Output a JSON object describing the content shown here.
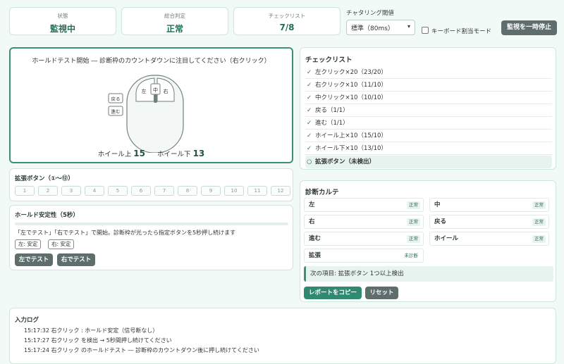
{
  "stats": [
    {
      "label": "状態",
      "value": "監視中"
    },
    {
      "label": "総合判定",
      "value": "正常"
    },
    {
      "label": "チェックリスト",
      "value": "7/8"
    }
  ],
  "controls": {
    "chatter_label": "チャタリング閾値",
    "chatter_value": "標準（80ms）",
    "keyboard_mode_label": "キーボード割当モード",
    "pause_button": "監視を一時停止"
  },
  "main": {
    "instruction": "ホールドテスト開始 ― 診断枠のカウントダウンに注目してください（右クリック）",
    "mouse": {
      "left": "左",
      "middle": "中",
      "right": "右",
      "back": "戻る",
      "forward": "進む"
    },
    "wheel_up_label": "ホイール上",
    "wheel_up_value": "15",
    "wheel_down_label": "ホイール下",
    "wheel_down_value": "13"
  },
  "extended": {
    "title": "拡張ボタン（①〜⑫）",
    "buttons": [
      "1",
      "2",
      "3",
      "4",
      "5",
      "6",
      "7",
      "8",
      "9",
      "10",
      "11",
      "12"
    ]
  },
  "hold": {
    "title": "ホールド安定性（5秒）",
    "progress": 0,
    "description": "「左でテスト」「右でテスト」で開始。診断枠が光ったら指定ボタンを5秒押し続けます",
    "left_status": "左: 安定",
    "right_status": "右: 安定",
    "left_test_button": "左でテスト",
    "right_test_button": "右でテスト"
  },
  "checklist": {
    "title": "チェックリスト",
    "items": [
      {
        "mark": "✓",
        "label": "左クリック×20（23/20）"
      },
      {
        "mark": "✓",
        "label": "右クリック×10（11/10）"
      },
      {
        "mark": "✓",
        "label": "中クリック×10（10/10）"
      },
      {
        "mark": "✓",
        "label": "戻る（1/1）"
      },
      {
        "mark": "✓",
        "label": "進む（1/1）"
      },
      {
        "mark": "✓",
        "label": "ホイール上×10（15/10）"
      },
      {
        "mark": "✓",
        "label": "ホイール下×10（13/10）"
      },
      {
        "mark": "○",
        "label": "拡張ボタン（未検出）"
      }
    ]
  },
  "diagnosis": {
    "title": "診断カルテ",
    "cells": [
      {
        "name": "左",
        "status": "正常"
      },
      {
        "name": "中",
        "status": "正常"
      },
      {
        "name": "右",
        "status": "正常"
      },
      {
        "name": "戻る",
        "status": "正常"
      },
      {
        "name": "進む",
        "status": "正常"
      },
      {
        "name": "ホイール",
        "status": "正常"
      },
      {
        "name": "拡張",
        "status": "未診断"
      }
    ],
    "next": "次の項目: 拡張ボタン 1つ以上検出",
    "copy_button": "レポートをコピー",
    "reset_button": "リセット"
  },
  "log": {
    "title": "入力ログ",
    "lines": [
      "15:17:32  右クリック : ホールド安定（信号断なし）",
      "15:17:27  右クリック を検出 → 5秒間押し続けてください",
      "15:17:24  右クリック のホールドテスト ― 診断枠のカウントダウン後に押し続けてください"
    ]
  },
  "colors": {
    "accent": "#3f8f77",
    "teal_button": "#2f8a6f",
    "dark_button": "#5e6e6c",
    "background": "#f1faf6"
  }
}
